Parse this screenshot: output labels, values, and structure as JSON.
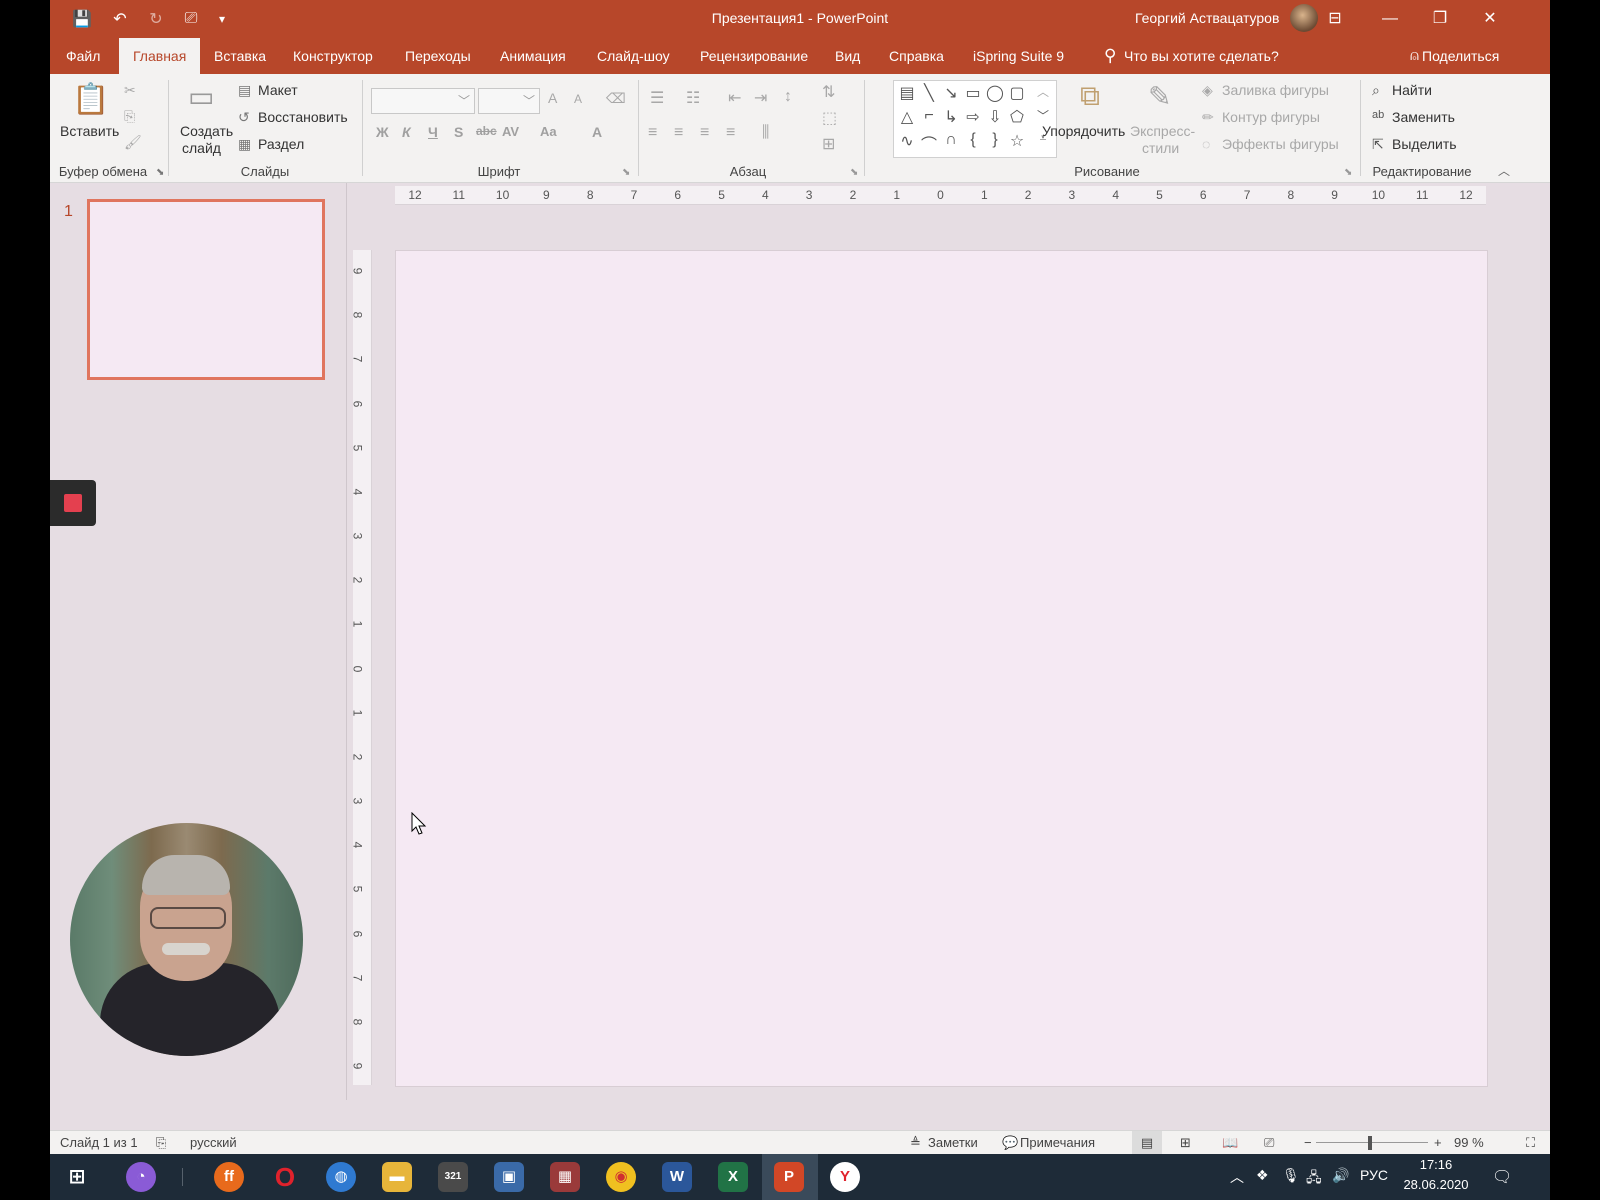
{
  "window": {
    "title": "Презентация1  -  PowerPoint",
    "user": "Георгий Аствацатуров",
    "controls": [
      "—",
      "❐",
      "✕"
    ]
  },
  "qat": {
    "save": "💾",
    "undo": "↶",
    "redo": "↻",
    "present": "⎚",
    "more": "▾"
  },
  "tabs": [
    {
      "label": "Файл"
    },
    {
      "label": "Главная"
    },
    {
      "label": "Вставка"
    },
    {
      "label": "Конструктор"
    },
    {
      "label": "Переходы"
    },
    {
      "label": "Анимация"
    },
    {
      "label": "Слайд-шоу"
    },
    {
      "label": "Рецензирование"
    },
    {
      "label": "Вид"
    },
    {
      "label": "Справка"
    },
    {
      "label": "iSpring Suite 9"
    }
  ],
  "active_tab": "Главная",
  "tellme": "Что вы хотите сделать?",
  "share": "Поделиться",
  "ribbon": {
    "clipboard": {
      "paste": "Вставить",
      "label": "Буфер обмена"
    },
    "slides": {
      "new_slide": "Создать",
      "new_slide2": "слайд",
      "layout": "Макет",
      "reset": "Восстановить",
      "section": "Раздел",
      "label": "Слайды"
    },
    "font": {
      "label": "Шрифт",
      "bold": "Ж",
      "italic": "К",
      "underline": "Ч",
      "shadow": "S",
      "strike": "abc",
      "spacing": "AV",
      "case": "Aa",
      "color": "A",
      "grow": "A",
      "shrink": "A"
    },
    "paragraph": {
      "label": "Абзац"
    },
    "drawing": {
      "arrange": "Упорядочить",
      "quick1": "Экспресс-",
      "quick2": "стили",
      "fill": "Заливка фигуры",
      "outline": "Контур фигуры",
      "effects": "Эффекты фигуры",
      "label": "Рисование"
    },
    "editing": {
      "find": "Найти",
      "replace": "Заменить",
      "select": "Выделить",
      "label": "Редактирование"
    }
  },
  "thumbnails": {
    "slide_number": "1"
  },
  "hruler": [
    "12",
    "11",
    "10",
    "9",
    "8",
    "7",
    "6",
    "5",
    "4",
    "3",
    "2",
    "1",
    "0",
    "1",
    "2",
    "3",
    "4",
    "5",
    "6",
    "7",
    "8",
    "9",
    "10",
    "11",
    "12"
  ],
  "vruler": [
    "9",
    "8",
    "7",
    "6",
    "5",
    "4",
    "3",
    "2",
    "1",
    "0",
    "1",
    "2",
    "3",
    "4",
    "5",
    "6",
    "7",
    "8",
    "9"
  ],
  "status": {
    "slide_of": "Слайд 1 из 1",
    "language": "русский",
    "notes": "Заметки",
    "comments": "Примечания",
    "zoom_minus": "−",
    "zoom_plus": "+",
    "zoom": "99 %"
  },
  "taskbar": {
    "language": "РУС",
    "time": "17:16",
    "date": "28.06.2020"
  },
  "colors": {
    "accent": "#b7472a",
    "slide_bg": "#f5e9f3",
    "taskbar": "#1e2b38"
  }
}
